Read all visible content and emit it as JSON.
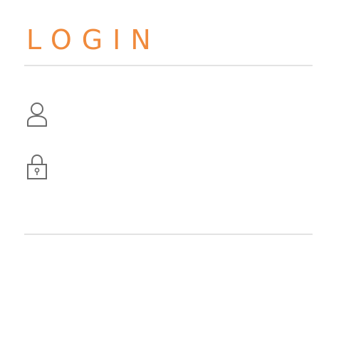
{
  "header": {
    "title": "LOGIN"
  },
  "form": {
    "username": {
      "icon": "user-icon",
      "value": "",
      "placeholder": ""
    },
    "password": {
      "icon": "lock-icon",
      "value": "",
      "placeholder": ""
    }
  },
  "colors": {
    "accent": "#f08a3c",
    "divider": "#e3e3e3",
    "icon": "#6b6b6b",
    "background": "#ffffff"
  }
}
